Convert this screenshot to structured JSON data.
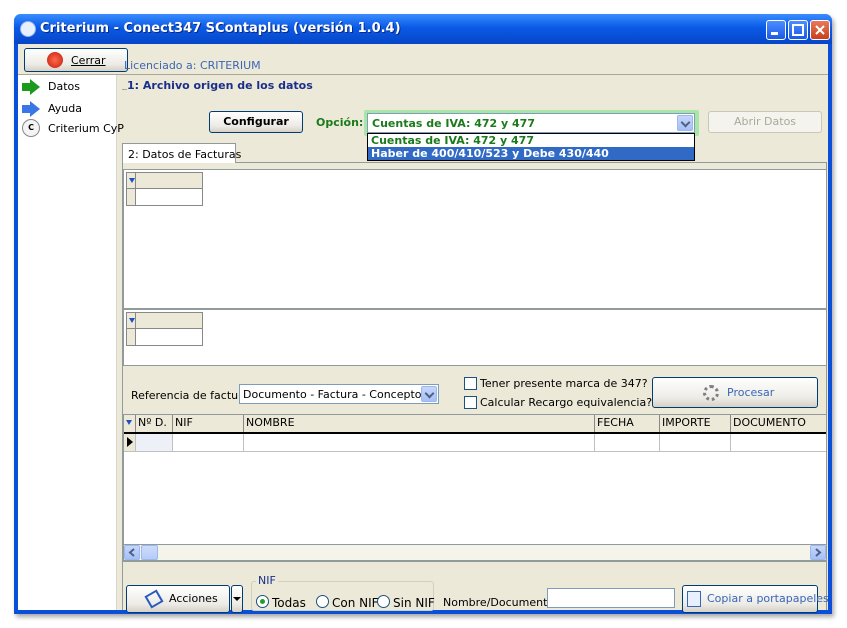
{
  "window": {
    "title": "Criterium - Conect347 SContaplus (versión 1.0.4)"
  },
  "toolbar": {
    "close_label": "Cerrar",
    "license": "Licenciado a: CRITERIUM"
  },
  "sidebar": {
    "items": [
      {
        "label": "Datos",
        "icon": "green-arrow-icon"
      },
      {
        "label": "Ayuda",
        "icon": "blue-arrow-icon"
      },
      {
        "label": "Criterium CyP",
        "icon": "cyp-logo-icon",
        "icon_text": "C CyP"
      }
    ]
  },
  "source": {
    "title": "1: Archivo origen de los datos",
    "configure_label": "Configurar",
    "option_label": "Opción:",
    "selected": "Cuentas de IVA: 472 y 477",
    "options": [
      "Cuentas de IVA: 472 y 477",
      "Haber de 400/410/523 y Debe 430/440"
    ],
    "open_label": "Abrir Datos"
  },
  "tabs": [
    {
      "label": "2: Datos de Facturas"
    }
  ],
  "invoice_ref": {
    "label": "Referencia de factura",
    "value": "Documento - Factura - Concepto"
  },
  "checks": [
    {
      "label": "Tener presente marca de 347?",
      "checked": false
    },
    {
      "label": "Calcular Recargo equivalencia?",
      "checked": false
    }
  ],
  "process_label": "Procesar",
  "table": {
    "columns": [
      "Nº D.",
      "NIF",
      "NOMBRE",
      "FECHA",
      "IMPORTE",
      "DOCUMENTO"
    ],
    "rows": [
      [
        "",
        "",
        "",
        "",
        "",
        ""
      ]
    ]
  },
  "actions_label": "Acciones",
  "nif": {
    "legend": "NIF",
    "options": [
      "Todas",
      "Con NIF",
      "Sin NIF"
    ],
    "selected": "Todas"
  },
  "search": {
    "label": "Nombre/Documento",
    "value": ""
  },
  "copy_label": "Copiar a portapapeles",
  "colors": {
    "title_bar": "#0a5ae6",
    "accent_green": "#1b7a1b",
    "selection": "#316ac5",
    "link_blue": "#3a66b6"
  }
}
